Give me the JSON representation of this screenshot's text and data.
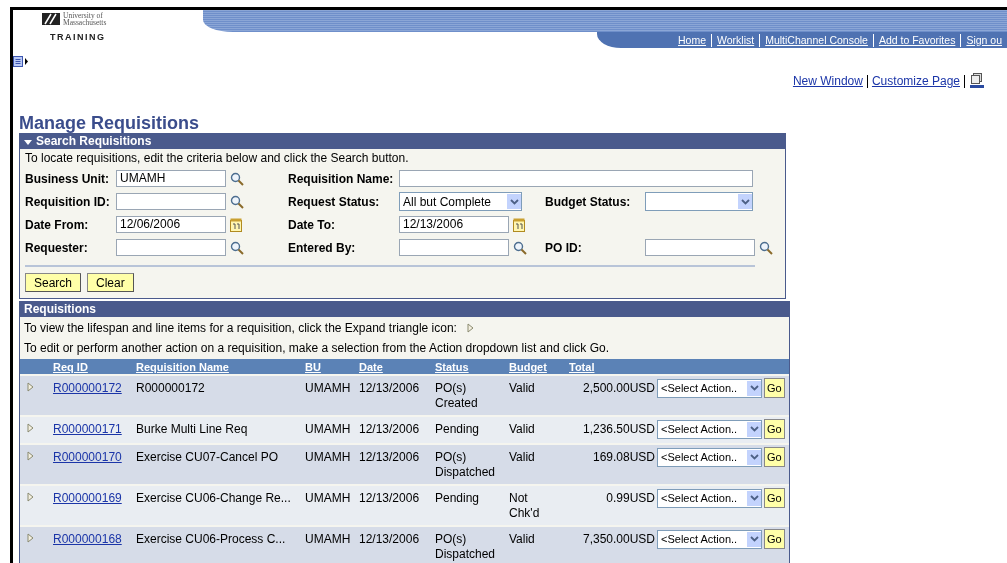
{
  "header": {
    "logo_lines": [
      "University of",
      "Massachusetts"
    ],
    "logo_subtitle": "TRAINING",
    "nav_links": [
      "Home",
      "Worklist",
      "MultiChannel Console",
      "Add to Favorites",
      "Sign ou"
    ]
  },
  "page_links": [
    "New Window",
    "Customize Page"
  ],
  "title": "Manage Requisitions",
  "search_panel": {
    "title": "Search Requisitions",
    "expanded": true,
    "instructions": "To locate requisitions, edit the criteria below and click the Search button.",
    "rows": [
      [
        {
          "label": "Business Unit:",
          "kind": "lookup",
          "value": "UMAMH"
        },
        {
          "label": "Requisition Name:",
          "kind": "wide"
        }
      ],
      [
        {
          "label": "Requisition ID:",
          "kind": "lookup"
        },
        {
          "label": "Request Status:",
          "kind": "select",
          "value": "All but Complete"
        },
        {
          "label": "Budget Status:",
          "kind": "select"
        }
      ],
      [
        {
          "label": "Date From:",
          "kind": "date",
          "value": "12/06/2006"
        },
        {
          "label": "Date To:",
          "kind": "date",
          "value": "12/13/2006"
        }
      ],
      [
        {
          "label": "Requester:",
          "kind": "lookup"
        },
        {
          "label": "Entered By:",
          "kind": "lookup"
        },
        {
          "label": "PO ID:",
          "kind": "lookup"
        }
      ]
    ],
    "buttons": [
      "Search",
      "Clear"
    ]
  },
  "requisitions": {
    "title": "Requisitions",
    "instructions": [
      "To view the lifespan and line items for a requisition, click the Expand triangle icon:",
      "To edit or perform another action on a requisition, make a selection from the Action dropdown list and click Go."
    ],
    "columns": [
      "Req ID",
      "Requisition Name",
      "BU",
      "Date",
      "Status",
      "Budget",
      "Total"
    ],
    "rows": [
      {
        "id": "R000000172",
        "name": "R000000172",
        "bu": "UMAMH",
        "date": "12/13/2006",
        "status": "PO(s) Created",
        "budget": "Valid",
        "total": "2,500.00USD",
        "action": "<Select Action..",
        "go": "Go"
      },
      {
        "id": "R000000171",
        "name": "Burke Multi Line Req",
        "bu": "UMAMH",
        "date": "12/13/2006",
        "status": "Pending",
        "budget": "Valid",
        "total": "1,236.50USD",
        "action": "<Select Action..",
        "go": "Go"
      },
      {
        "id": "R000000170",
        "name": "Exercise CU07-Cancel PO",
        "bu": "UMAMH",
        "date": "12/13/2006",
        "status": "PO(s) Dispatched",
        "budget": "Valid",
        "total": "169.08USD",
        "action": "<Select Action..",
        "go": "Go"
      },
      {
        "id": "R000000169",
        "name": "Exercise CU06-Change Re...",
        "bu": "UMAMH",
        "date": "12/13/2006",
        "status": "Pending",
        "budget": "Not Chk'd",
        "total": "0.99USD",
        "action": "<Select Action..",
        "go": "Go"
      },
      {
        "id": "R000000168",
        "name": "Exercise CU06-Process C...",
        "bu": "UMAMH",
        "date": "12/13/2006",
        "status": "PO(s) Dispatched",
        "budget": "Valid",
        "total": "7,350.00USD",
        "action": "<Select Action..",
        "go": "Go"
      }
    ]
  }
}
